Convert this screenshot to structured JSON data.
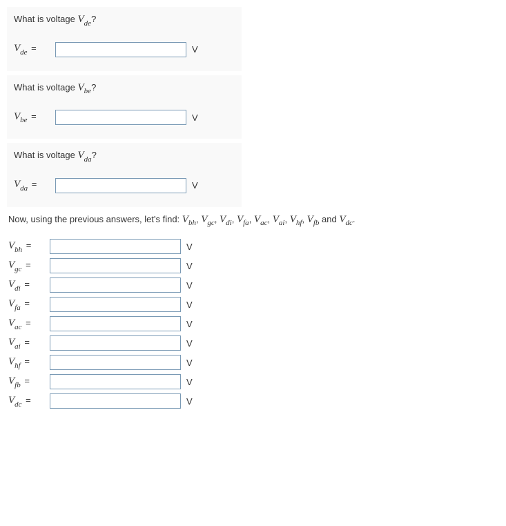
{
  "questions": [
    {
      "prompt_prefix": "What is voltage ",
      "var": "V",
      "sub": "de",
      "prompt_suffix": "?",
      "unit": "V"
    },
    {
      "prompt_prefix": "What is voltage ",
      "var": "V",
      "sub": "be",
      "prompt_suffix": "?",
      "unit": "V"
    },
    {
      "prompt_prefix": "What is voltage ",
      "var": "V",
      "sub": "da",
      "prompt_suffix": "?",
      "unit": "V"
    }
  ],
  "intro": {
    "prefix": "Now, using the previous answers, let's find: ",
    "terms": [
      {
        "var": "V",
        "sub": "bh"
      },
      {
        "var": "V",
        "sub": "gc"
      },
      {
        "var": "V",
        "sub": "di"
      },
      {
        "var": "V",
        "sub": "fa"
      },
      {
        "var": "V",
        "sub": "ac"
      },
      {
        "var": "V",
        "sub": "ai"
      },
      {
        "var": "V",
        "sub": "hf"
      },
      {
        "var": "V",
        "sub": "fb"
      }
    ],
    "joiner": ", ",
    "last_joiner": " and ",
    "last_term": {
      "var": "V",
      "sub": "dc"
    },
    "suffix": "."
  },
  "fields": [
    {
      "var": "V",
      "sub": "bh",
      "unit": "V"
    },
    {
      "var": "V",
      "sub": "gc",
      "unit": "V"
    },
    {
      "var": "V",
      "sub": "di",
      "unit": "V"
    },
    {
      "var": "V",
      "sub": "fa",
      "unit": "V"
    },
    {
      "var": "V",
      "sub": "ac",
      "unit": "V"
    },
    {
      "var": "V",
      "sub": "ai",
      "unit": "V"
    },
    {
      "var": "V",
      "sub": "hf",
      "unit": "V"
    },
    {
      "var": "V",
      "sub": "fb",
      "unit": "V"
    },
    {
      "var": "V",
      "sub": "dc",
      "unit": "V"
    }
  ],
  "equals": "="
}
